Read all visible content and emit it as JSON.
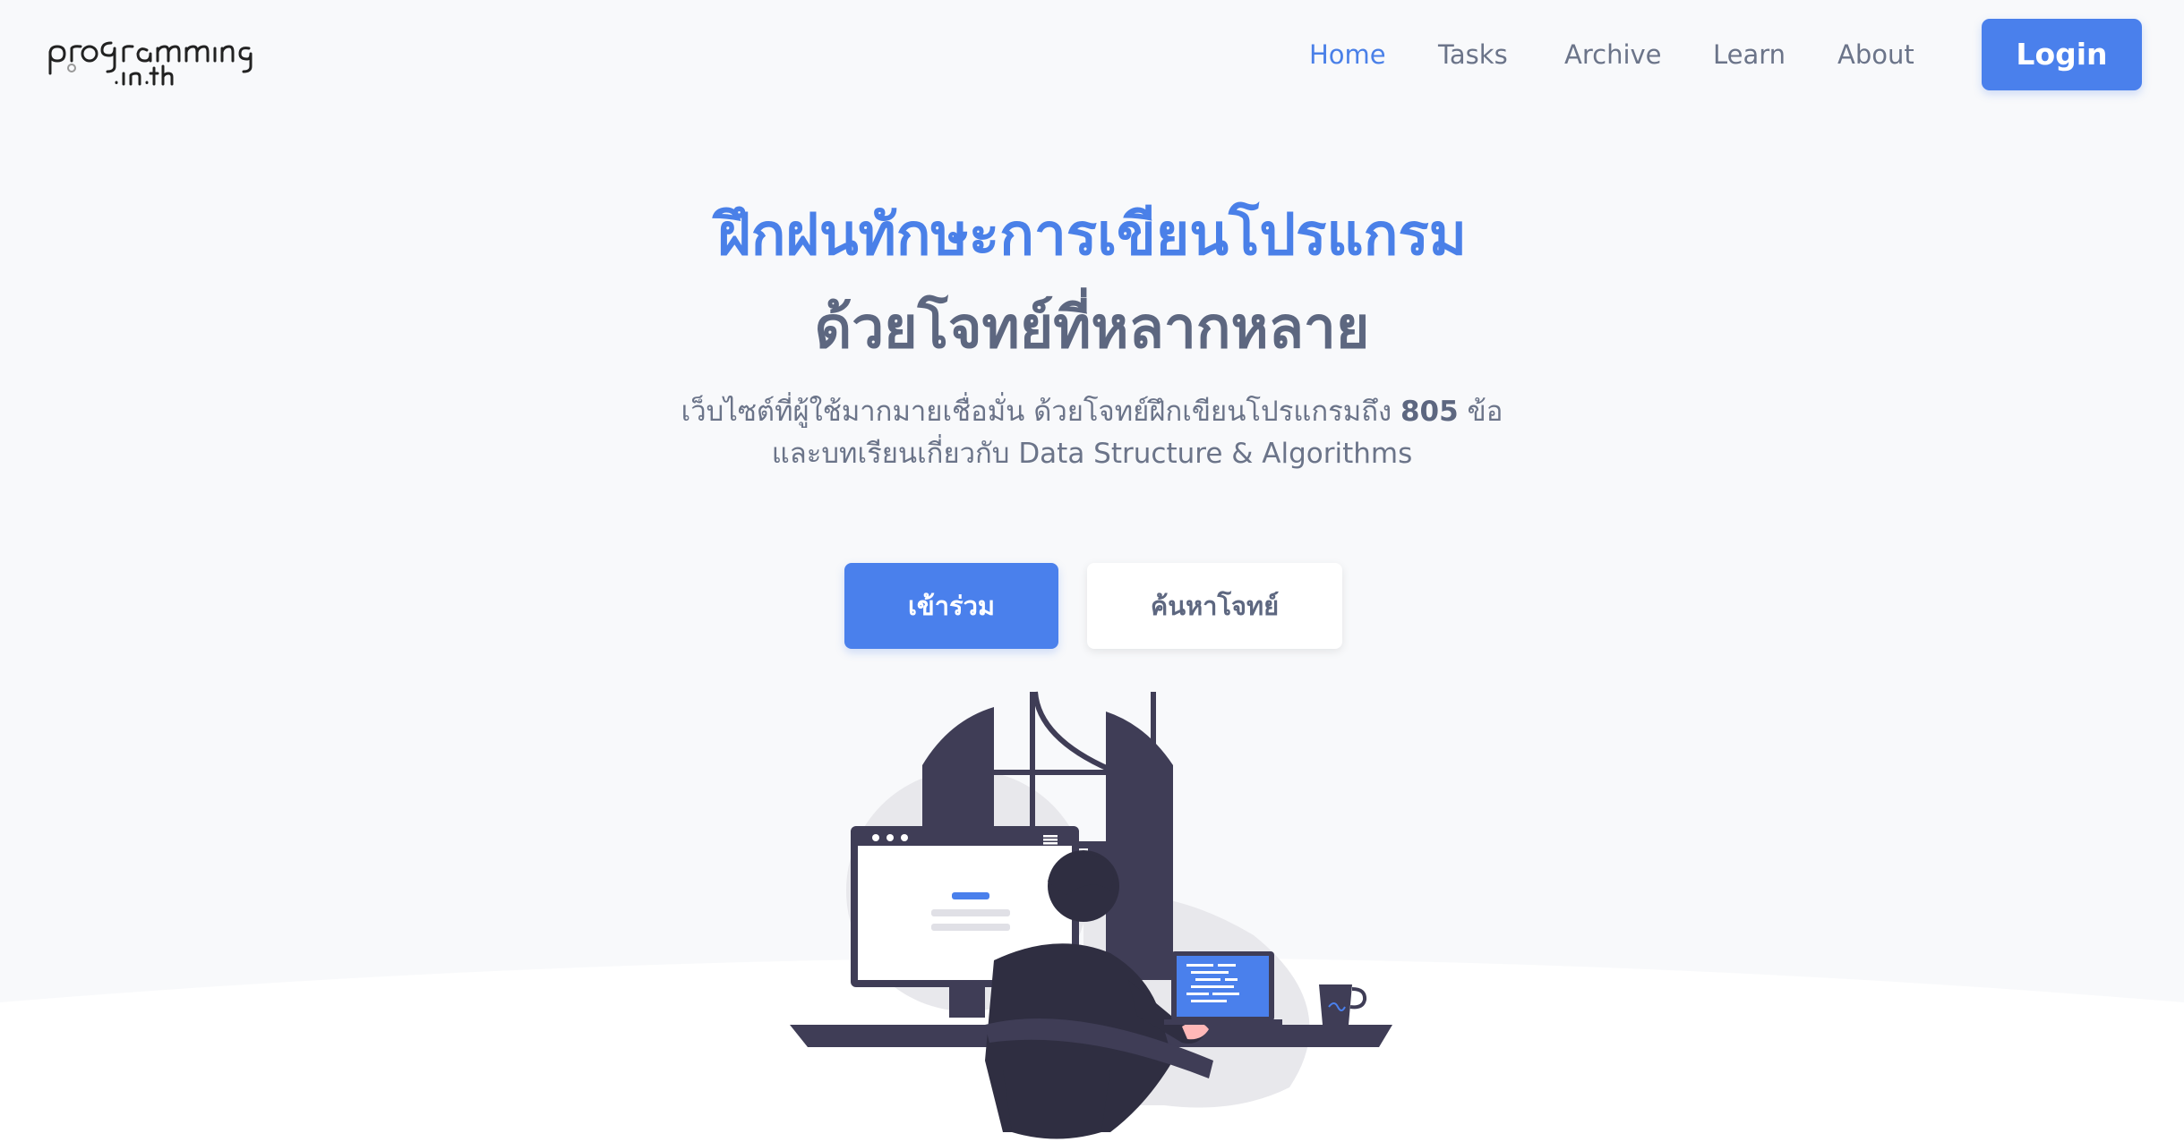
{
  "header": {
    "logo_text_top": "programming",
    "logo_text_bottom": ".in.th",
    "nav": [
      "Home",
      "Tasks",
      "Archive",
      "Learn",
      "About"
    ],
    "active_nav": "Home",
    "login_label": "Login"
  },
  "hero": {
    "title_line1": "ฝึกฝนทักษะการเขียนโปรแกรม",
    "title_line2": "ด้วยโจทย์ที่หลากหลาย",
    "subtitle_before_count": "เว็บไซต์ที่ผู้ใช้มากมายเชื่อมั่น ด้วยโจทย์ฝึกเขียนโปรแกรมถึง",
    "task_count": "805",
    "subtitle_after_count": "ข้อ",
    "subtitle_line2": "และบทเรียนเกี่ยวกับ Data Structure & Algorithms",
    "join_label": "เข้าร่วม",
    "search_label": "ค้นหาโจทย์"
  },
  "colors": {
    "accent": "#4a80ec",
    "text_muted": "#6b7489",
    "text_dark": "#5d6780",
    "background": "#f8f9fb",
    "illustration_dark": "#3f3d56"
  },
  "icons": {
    "logo": "programming-in-th-logo",
    "hero_art": "person-at-desk-illustration"
  }
}
